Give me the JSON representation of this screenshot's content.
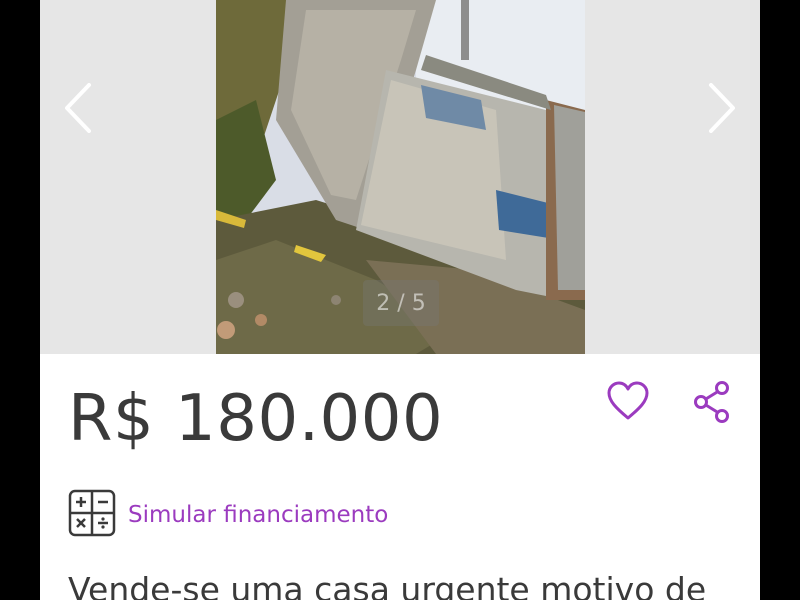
{
  "gallery": {
    "counter_text": "2 / 5",
    "prev_icon": "chevron-left-icon",
    "next_icon": "chevron-right-icon"
  },
  "listing": {
    "price": "R$ 180.000",
    "favorite_icon": "heart-icon",
    "share_icon": "share-icon",
    "finance_icon": "calculator-icon",
    "finance_label": "Simular financiamento",
    "description": "Vende-se uma casa urgente motivo de"
  },
  "colors": {
    "accent": "#9b3bbf",
    "price_text": "#3a3a3a",
    "gallery_bg": "#e6e6e6"
  }
}
